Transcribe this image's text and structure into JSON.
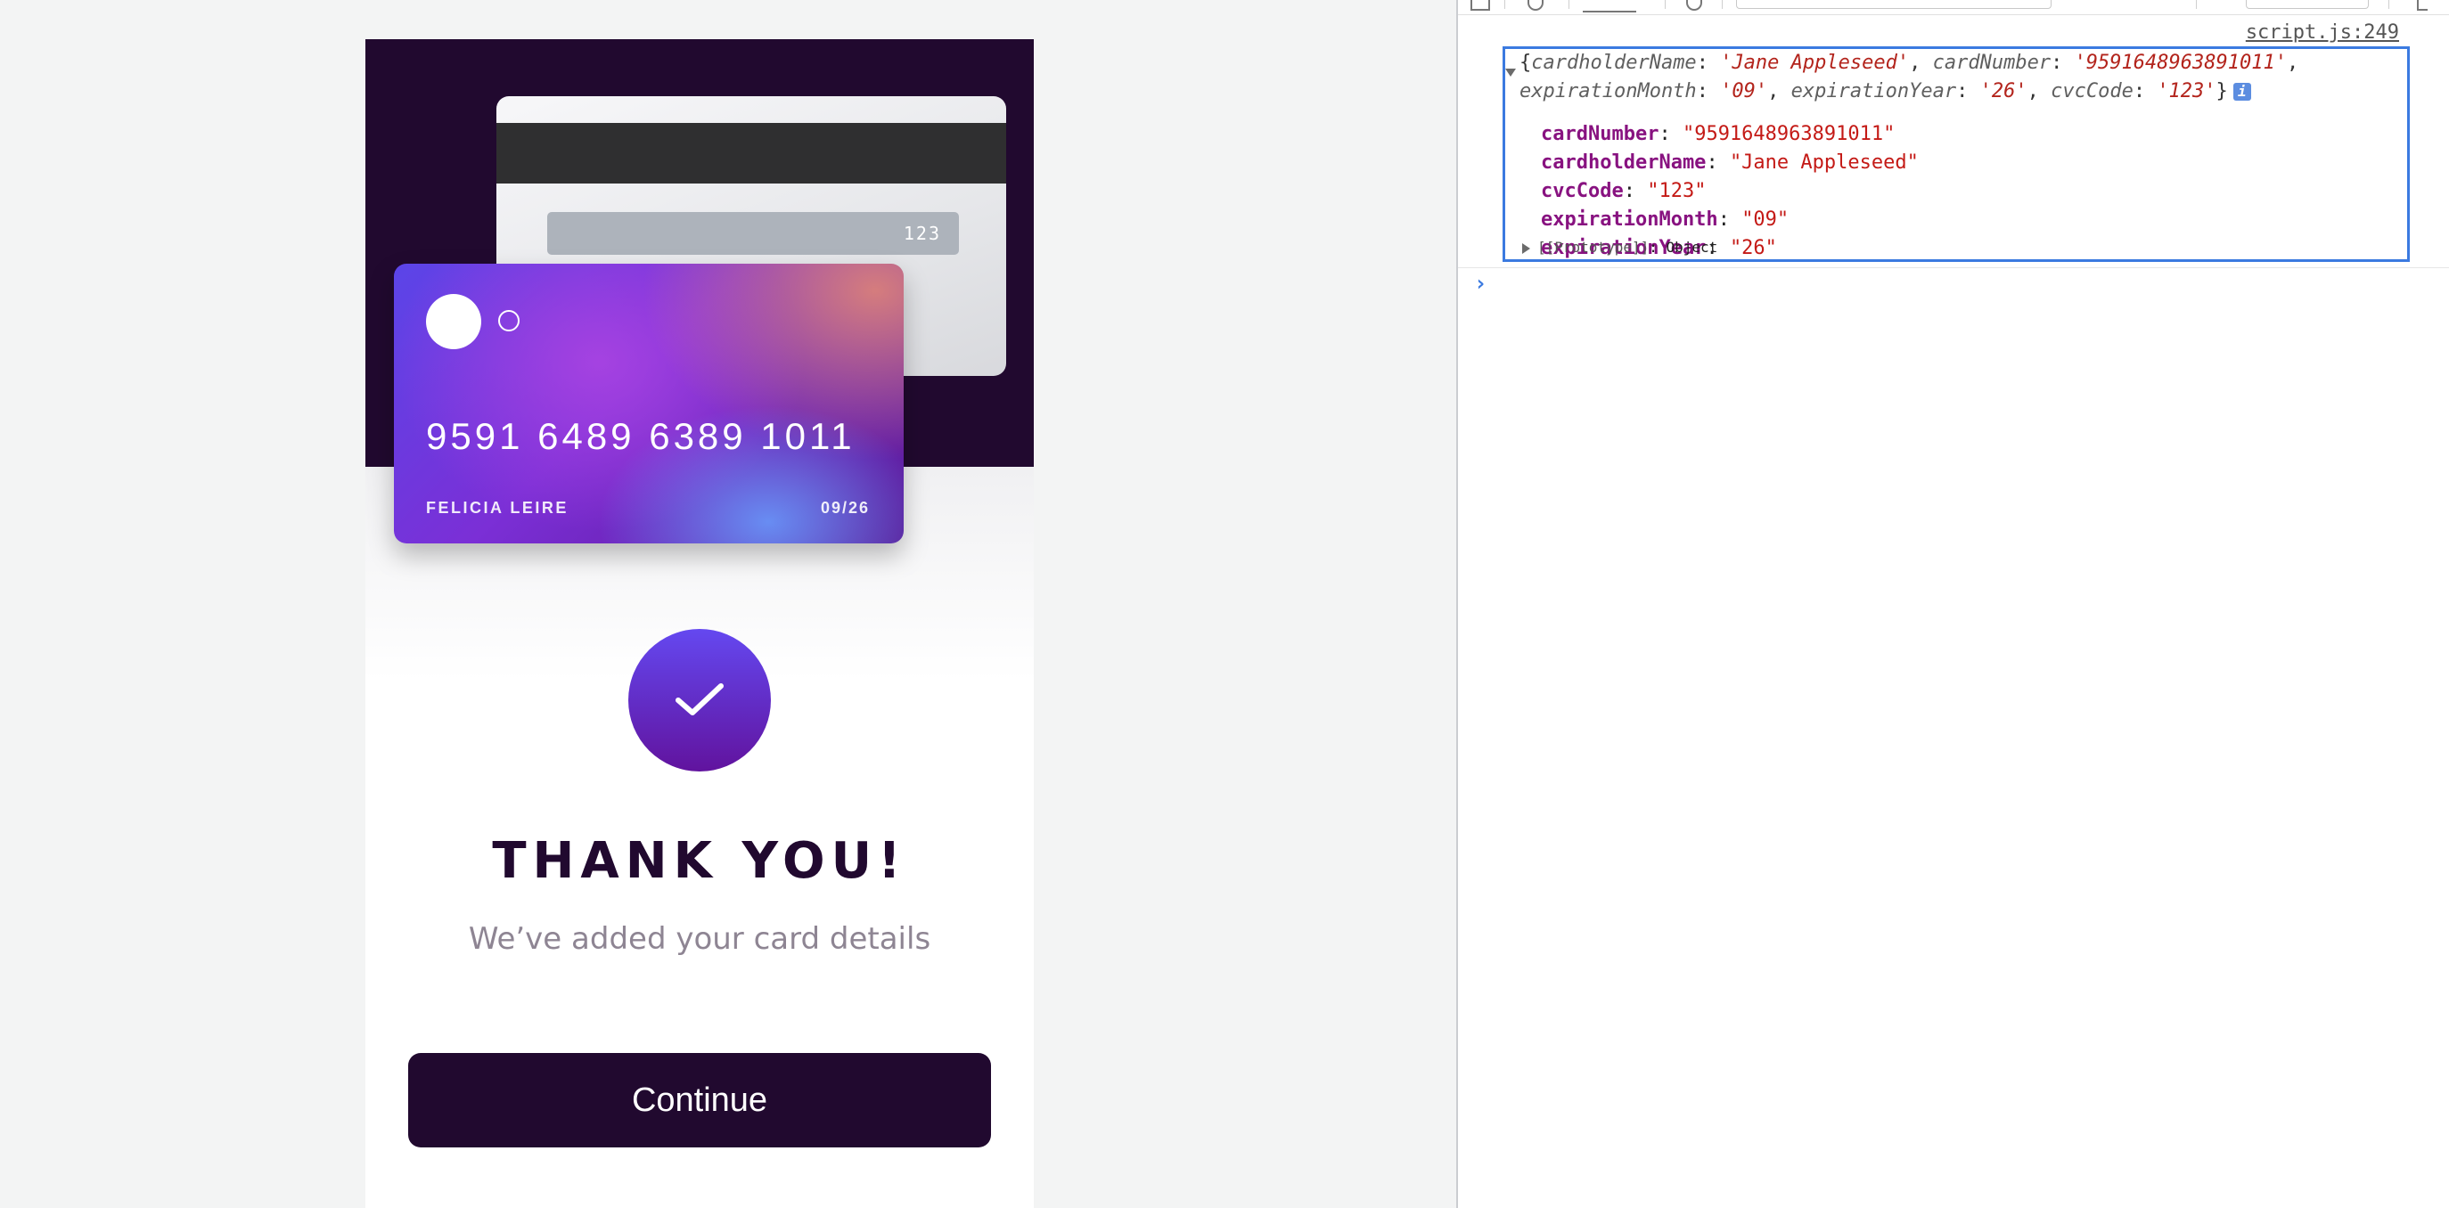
{
  "card": {
    "number": "9591 6489 6389 1011",
    "holder": "FELICIA LEIRE",
    "expiry": "09/26",
    "cvc": "123"
  },
  "success": {
    "title": "THANK YOU!",
    "subtitle": "We’ve added your card details",
    "continue_label": "Continue"
  },
  "devtools": {
    "source_link": "script.js:249",
    "summary": {
      "open": "{",
      "close": "}",
      "items": [
        {
          "key": "cardholderName",
          "value": "'Jane Appleseed'"
        },
        {
          "key": "cardNumber",
          "value": "'9591648963891011'"
        },
        {
          "key": "expirationMonth",
          "value": "'09'"
        },
        {
          "key": "expirationYear",
          "value": "'26'"
        },
        {
          "key": "cvcCode",
          "value": "'123'"
        }
      ],
      "info_badge": "i"
    },
    "properties": [
      {
        "key": "cardNumber",
        "value": "\"9591648963891011\""
      },
      {
        "key": "cardholderName",
        "value": "\"Jane Appleseed\""
      },
      {
        "key": "cvcCode",
        "value": "\"123\""
      },
      {
        "key": "expirationMonth",
        "value": "\"09\""
      },
      {
        "key": "expirationYear",
        "value": "\"26\""
      }
    ],
    "prototype": {
      "key": "[[Prototype]]",
      "value": "Object"
    },
    "prompt_glyph": "›"
  }
}
